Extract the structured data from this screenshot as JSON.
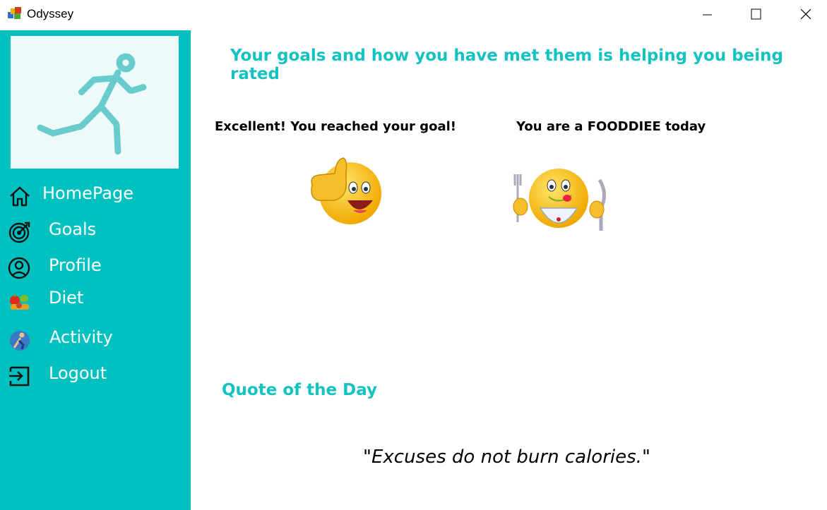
{
  "window": {
    "title": "Odyssey"
  },
  "sidebar": {
    "items": [
      {
        "label": "HomePage",
        "icon": "home-icon"
      },
      {
        "label": "Goals",
        "icon": "target-icon"
      },
      {
        "label": "Profile",
        "icon": "user-circle-icon"
      },
      {
        "label": "Diet",
        "icon": "fruits-icon"
      },
      {
        "label": "Activity",
        "icon": "runner-icon"
      },
      {
        "label": "Logout",
        "icon": "logout-icon"
      }
    ]
  },
  "main": {
    "heading": "Your goals and how you have met them is helping you being rated",
    "goal_message": "Excellent! You reached your goal!",
    "diet_message": "You are a FOODDIEE today",
    "quote_heading": "Quote of the Day",
    "quote_open": "\"",
    "quote_text": "Excuses do not burn calories.",
    "quote_close": "\""
  },
  "colors": {
    "accent": "#00c0c0",
    "heading": "#14c2c2"
  }
}
